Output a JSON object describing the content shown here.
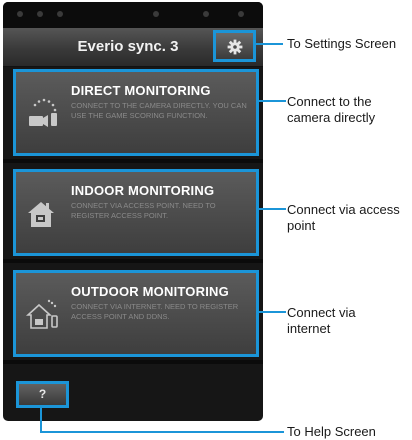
{
  "app": {
    "title": "Everio sync. 3"
  },
  "buttons": {
    "help_label": "?"
  },
  "cards": [
    {
      "title": "DIRECT MONITORING",
      "description": "CONNECT TO THE CAMERA DIRECTLY. YOU CAN USE THE GAME SCORING FUNCTION.",
      "icon": "direct-camera-icon"
    },
    {
      "title": "INDOOR MONITORING",
      "description": "CONNECT VIA ACCESS POINT. NEED TO REGISTER ACCESS POINT.",
      "icon": "indoor-house-icon"
    },
    {
      "title": "OUTDOOR MONITORING",
      "description": "CONNECT VIA INTERNET. NEED TO REGISTER ACCESS POINT AND DDNS.",
      "icon": "outdoor-house-icon"
    }
  ],
  "callouts": {
    "settings": "To Settings Screen",
    "direct": [
      "Connect to the",
      "camera directly"
    ],
    "indoor": [
      "Connect via access",
      "point"
    ],
    "outdoor": [
      "Connect via",
      "internet"
    ],
    "help": "To Help Screen"
  },
  "colors": {
    "highlight": "#1b95d8",
    "background": "#161616",
    "card": "#4a4a4a"
  },
  "icons": {
    "settings": "gear-icon"
  }
}
